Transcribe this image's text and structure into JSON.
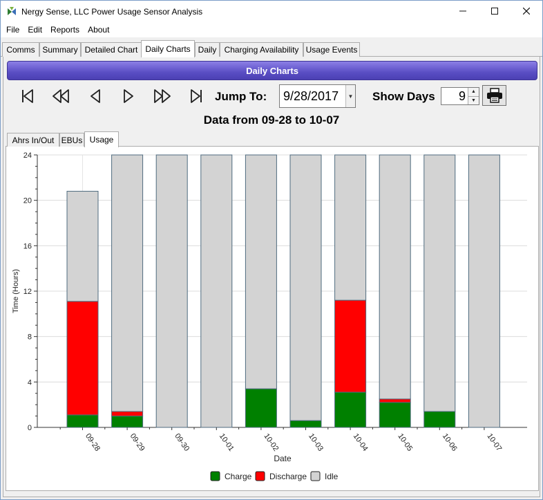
{
  "window": {
    "title": "Nergy Sense, LLC Power Usage Sensor Analysis"
  },
  "menu": [
    "File",
    "Edit",
    "Reports",
    "About"
  ],
  "tabs": [
    "Comms",
    "Summary",
    "Detailed Chart",
    "Daily Charts",
    "Daily",
    "Charging Availability",
    "Usage Events"
  ],
  "active_tab": "Daily Charts",
  "header": {
    "title": "Daily Charts"
  },
  "nav": {
    "jump_label": "Jump To:",
    "date_value": "9/28/2017",
    "show_days_label": "Show Days",
    "show_days_value": "9"
  },
  "range_title": "Data from 09-28 to 10-07",
  "subtabs": [
    "Ahrs In/Out",
    "EBUs",
    "Usage"
  ],
  "active_subtab": "Usage",
  "colors": {
    "charge": "#008000",
    "discharge": "#ff0000",
    "idle": "#d3d3d3",
    "outline": "#4f6b7f",
    "header": "#5a4ec4"
  },
  "chart_data": {
    "type": "bar",
    "stacked": true,
    "categories": [
      "09-28",
      "09-29",
      "09-30",
      "10-01",
      "10-02",
      "10-03",
      "10-04",
      "10-05",
      "10-06",
      "10-07"
    ],
    "series": [
      {
        "name": "Charge",
        "values": [
          1.1,
          1.0,
          0,
          0,
          3.4,
          0.6,
          3.1,
          2.2,
          1.4,
          0
        ]
      },
      {
        "name": "Discharge",
        "values": [
          10.0,
          0.4,
          0,
          0,
          0,
          0,
          8.1,
          0.3,
          0,
          0
        ]
      },
      {
        "name": "Idle",
        "values": [
          9.7,
          22.6,
          24,
          24,
          20.6,
          23.4,
          12.8,
          21.5,
          22.6,
          24
        ]
      }
    ],
    "xlabel": "Date",
    "ylabel": "Time (Hours)",
    "ylim": [
      0,
      24
    ],
    "yticks": [
      0,
      4,
      8,
      12,
      16,
      20,
      24
    ],
    "grid": true,
    "legend_position": "bottom"
  }
}
